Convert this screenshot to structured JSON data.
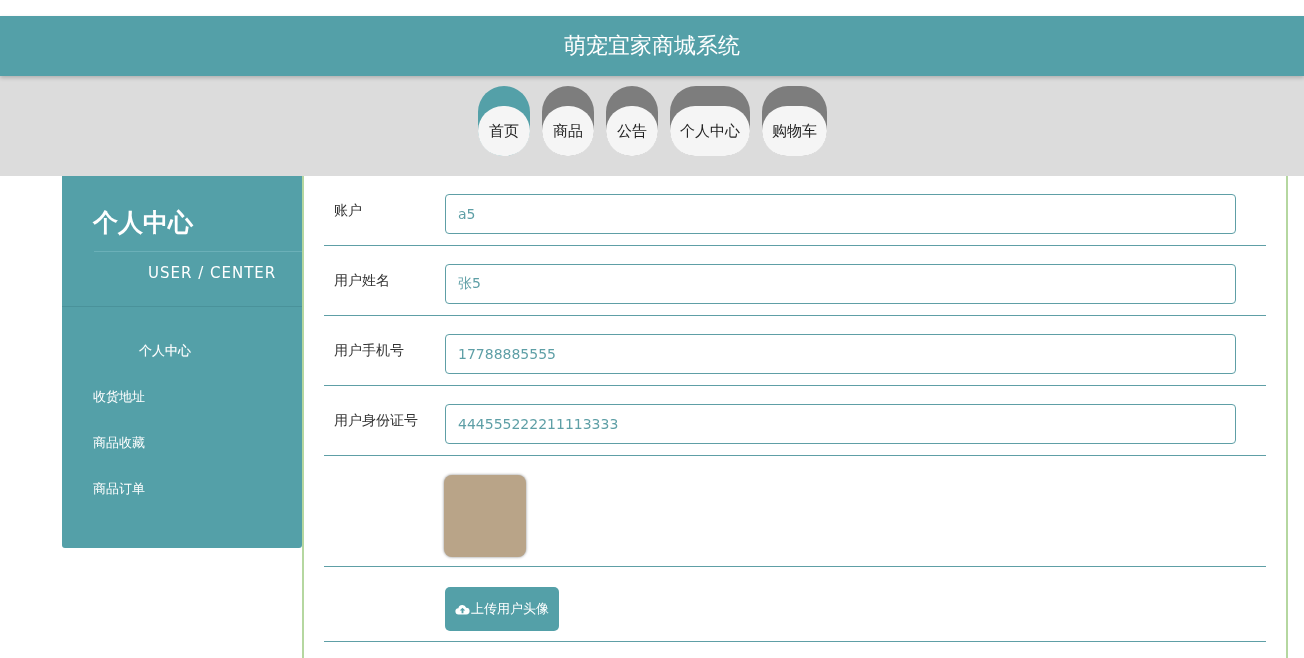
{
  "header": {
    "title": "萌宠宜家商城系统"
  },
  "nav": [
    {
      "label": "首页",
      "selected": true
    },
    {
      "label": "商品",
      "selected": false
    },
    {
      "label": "公告",
      "selected": false
    },
    {
      "label": "个人中心",
      "selected": false
    },
    {
      "label": "购物车",
      "selected": false
    }
  ],
  "sidebar": {
    "title": "个人中心",
    "subtitle": "USER / CENTER",
    "items": [
      {
        "label": "个人中心",
        "selected": true
      },
      {
        "label": "收货地址",
        "selected": false
      },
      {
        "label": "商品收藏",
        "selected": false
      },
      {
        "label": "商品订单",
        "selected": false
      }
    ]
  },
  "form": {
    "fields": [
      {
        "label": "账户",
        "value": "a5"
      },
      {
        "label": "用户姓名",
        "value": "张5"
      },
      {
        "label": "用户手机号",
        "value": "17788885555"
      },
      {
        "label": "用户身份证号",
        "value": "444555222211113333"
      }
    ],
    "upload_button": "上传用户头像"
  }
}
